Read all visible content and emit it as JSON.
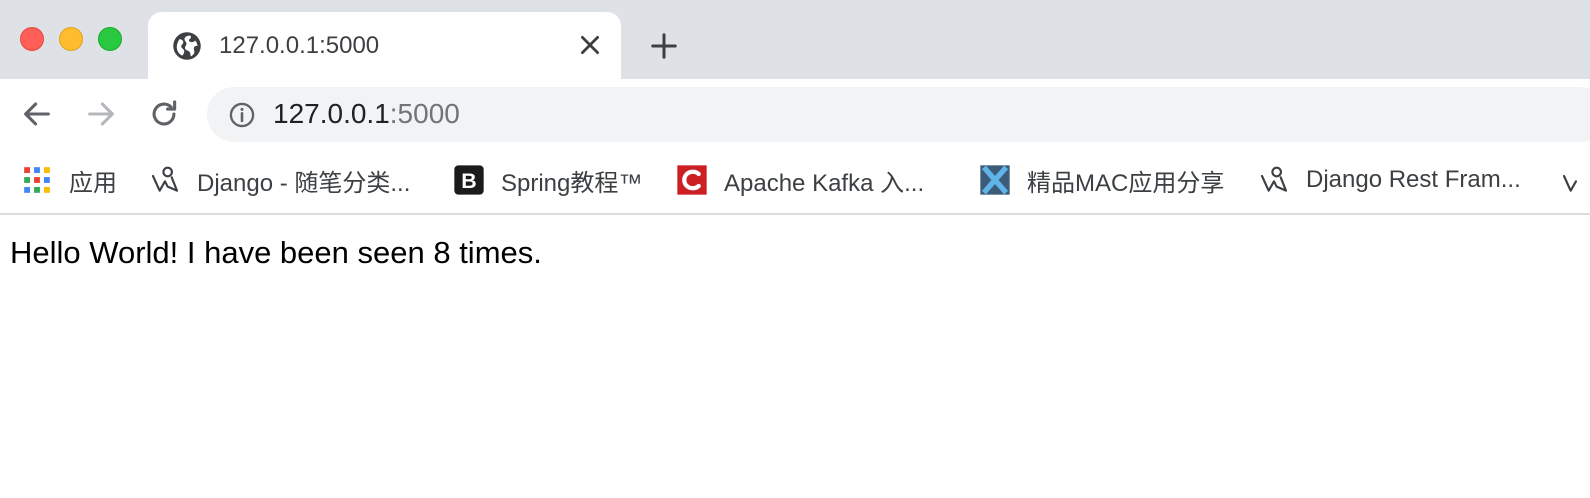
{
  "window": {
    "traffic_lights": [
      "close",
      "minimize",
      "maximize"
    ]
  },
  "tab": {
    "title": "127.0.0.1:5000",
    "favicon": "globe-icon",
    "close_icon": "close-icon"
  },
  "new_tab_icon": "plus-icon",
  "toolbar": {
    "back_icon": "back-arrow-icon",
    "forward_icon": "forward-arrow-icon",
    "reload_icon": "reload-icon"
  },
  "omnibox": {
    "info_icon": "info-icon",
    "host": "127.0.0.1",
    "port": ":5000"
  },
  "bookmarks": [
    {
      "label": "应用",
      "icon": "apps-grid-icon"
    },
    {
      "label": "Django - 随笔分类...",
      "icon": "django-figure-icon"
    },
    {
      "label": "Spring教程™",
      "icon": "b-logo-icon"
    },
    {
      "label": "Apache Kafka 入...",
      "icon": "c-logo-icon"
    },
    {
      "label": "精品MAC应用分享",
      "icon": "x-logo-icon"
    },
    {
      "label": "Django Rest Fram...",
      "icon": "django-figure-icon"
    }
  ],
  "page": {
    "text": "Hello World! I have been seen 8 times."
  },
  "colors": {
    "tabstrip_bg": "#dee1e6",
    "omnibox_bg": "#f1f3f4",
    "traffic_close": "#ff5f57",
    "traffic_min": "#febc2e",
    "traffic_max": "#28c840",
    "spring_logo": "#1b1b1b",
    "apache_logo": "#cc1f24",
    "mac_logo": "#3b5b78"
  }
}
